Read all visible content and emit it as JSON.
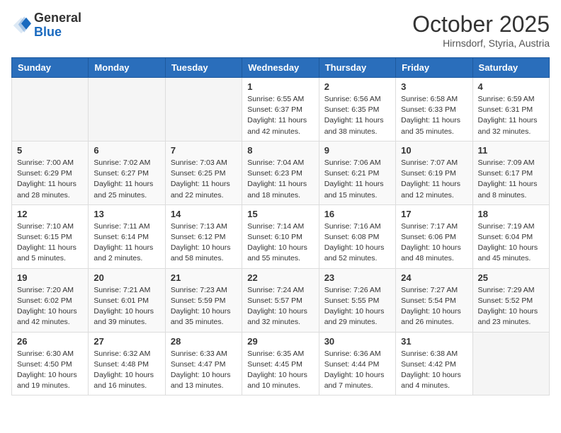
{
  "header": {
    "logo_general": "General",
    "logo_blue": "Blue",
    "month_title": "October 2025",
    "subtitle": "Hirnsdorf, Styria, Austria"
  },
  "weekdays": [
    "Sunday",
    "Monday",
    "Tuesday",
    "Wednesday",
    "Thursday",
    "Friday",
    "Saturday"
  ],
  "weeks": [
    [
      {
        "day": "",
        "details": ""
      },
      {
        "day": "",
        "details": ""
      },
      {
        "day": "",
        "details": ""
      },
      {
        "day": "1",
        "details": "Sunrise: 6:55 AM\nSunset: 6:37 PM\nDaylight: 11 hours and 42 minutes."
      },
      {
        "day": "2",
        "details": "Sunrise: 6:56 AM\nSunset: 6:35 PM\nDaylight: 11 hours and 38 minutes."
      },
      {
        "day": "3",
        "details": "Sunrise: 6:58 AM\nSunset: 6:33 PM\nDaylight: 11 hours and 35 minutes."
      },
      {
        "day": "4",
        "details": "Sunrise: 6:59 AM\nSunset: 6:31 PM\nDaylight: 11 hours and 32 minutes."
      }
    ],
    [
      {
        "day": "5",
        "details": "Sunrise: 7:00 AM\nSunset: 6:29 PM\nDaylight: 11 hours and 28 minutes."
      },
      {
        "day": "6",
        "details": "Sunrise: 7:02 AM\nSunset: 6:27 PM\nDaylight: 11 hours and 25 minutes."
      },
      {
        "day": "7",
        "details": "Sunrise: 7:03 AM\nSunset: 6:25 PM\nDaylight: 11 hours and 22 minutes."
      },
      {
        "day": "8",
        "details": "Sunrise: 7:04 AM\nSunset: 6:23 PM\nDaylight: 11 hours and 18 minutes."
      },
      {
        "day": "9",
        "details": "Sunrise: 7:06 AM\nSunset: 6:21 PM\nDaylight: 11 hours and 15 minutes."
      },
      {
        "day": "10",
        "details": "Sunrise: 7:07 AM\nSunset: 6:19 PM\nDaylight: 11 hours and 12 minutes."
      },
      {
        "day": "11",
        "details": "Sunrise: 7:09 AM\nSunset: 6:17 PM\nDaylight: 11 hours and 8 minutes."
      }
    ],
    [
      {
        "day": "12",
        "details": "Sunrise: 7:10 AM\nSunset: 6:15 PM\nDaylight: 11 hours and 5 minutes."
      },
      {
        "day": "13",
        "details": "Sunrise: 7:11 AM\nSunset: 6:14 PM\nDaylight: 11 hours and 2 minutes."
      },
      {
        "day": "14",
        "details": "Sunrise: 7:13 AM\nSunset: 6:12 PM\nDaylight: 10 hours and 58 minutes."
      },
      {
        "day": "15",
        "details": "Sunrise: 7:14 AM\nSunset: 6:10 PM\nDaylight: 10 hours and 55 minutes."
      },
      {
        "day": "16",
        "details": "Sunrise: 7:16 AM\nSunset: 6:08 PM\nDaylight: 10 hours and 52 minutes."
      },
      {
        "day": "17",
        "details": "Sunrise: 7:17 AM\nSunset: 6:06 PM\nDaylight: 10 hours and 48 minutes."
      },
      {
        "day": "18",
        "details": "Sunrise: 7:19 AM\nSunset: 6:04 PM\nDaylight: 10 hours and 45 minutes."
      }
    ],
    [
      {
        "day": "19",
        "details": "Sunrise: 7:20 AM\nSunset: 6:02 PM\nDaylight: 10 hours and 42 minutes."
      },
      {
        "day": "20",
        "details": "Sunrise: 7:21 AM\nSunset: 6:01 PM\nDaylight: 10 hours and 39 minutes."
      },
      {
        "day": "21",
        "details": "Sunrise: 7:23 AM\nSunset: 5:59 PM\nDaylight: 10 hours and 35 minutes."
      },
      {
        "day": "22",
        "details": "Sunrise: 7:24 AM\nSunset: 5:57 PM\nDaylight: 10 hours and 32 minutes."
      },
      {
        "day": "23",
        "details": "Sunrise: 7:26 AM\nSunset: 5:55 PM\nDaylight: 10 hours and 29 minutes."
      },
      {
        "day": "24",
        "details": "Sunrise: 7:27 AM\nSunset: 5:54 PM\nDaylight: 10 hours and 26 minutes."
      },
      {
        "day": "25",
        "details": "Sunrise: 7:29 AM\nSunset: 5:52 PM\nDaylight: 10 hours and 23 minutes."
      }
    ],
    [
      {
        "day": "26",
        "details": "Sunrise: 6:30 AM\nSunset: 4:50 PM\nDaylight: 10 hours and 19 minutes."
      },
      {
        "day": "27",
        "details": "Sunrise: 6:32 AM\nSunset: 4:48 PM\nDaylight: 10 hours and 16 minutes."
      },
      {
        "day": "28",
        "details": "Sunrise: 6:33 AM\nSunset: 4:47 PM\nDaylight: 10 hours and 13 minutes."
      },
      {
        "day": "29",
        "details": "Sunrise: 6:35 AM\nSunset: 4:45 PM\nDaylight: 10 hours and 10 minutes."
      },
      {
        "day": "30",
        "details": "Sunrise: 6:36 AM\nSunset: 4:44 PM\nDaylight: 10 hours and 7 minutes."
      },
      {
        "day": "31",
        "details": "Sunrise: 6:38 AM\nSunset: 4:42 PM\nDaylight: 10 hours and 4 minutes."
      },
      {
        "day": "",
        "details": ""
      }
    ]
  ]
}
